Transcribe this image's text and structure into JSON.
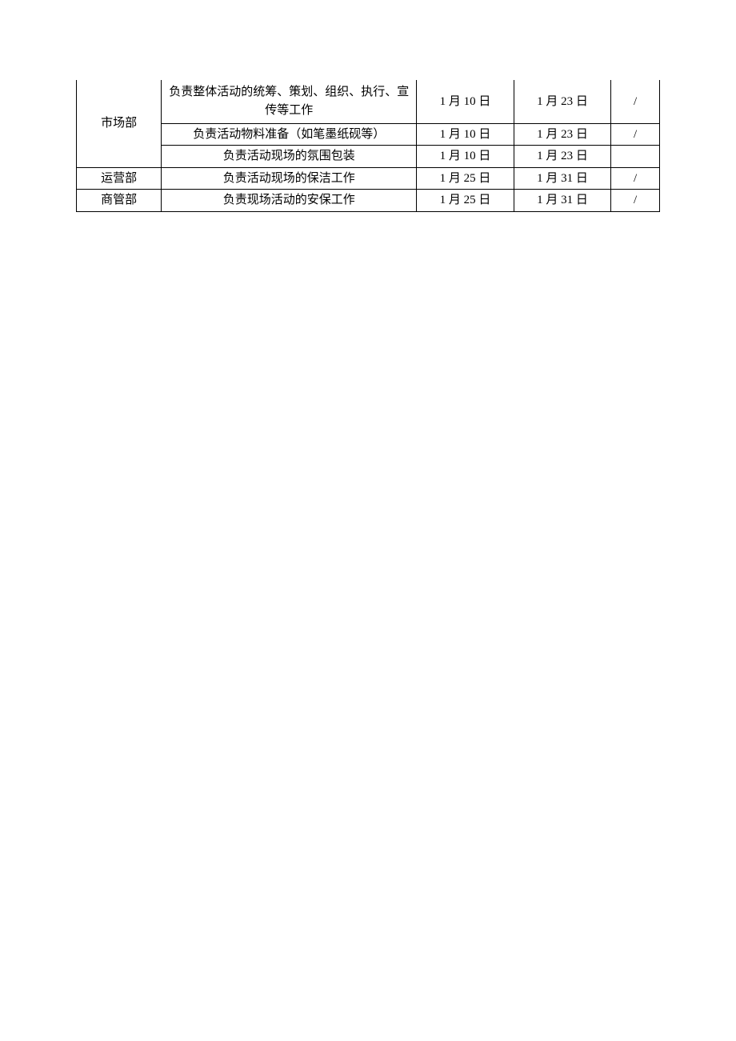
{
  "table": {
    "rows": [
      {
        "dept": "市场部",
        "dept_rowspan": 3,
        "task": "负责整体活动的统筹、策划、组织、执行、宣传等工作",
        "start": "1 月 10 日",
        "end": "1 月 23 日",
        "last": "/",
        "tall": true
      },
      {
        "task": "负责活动物料准备（如笔墨纸砚等）",
        "start": "1 月 10 日",
        "end": "1 月 23 日",
        "last": "/"
      },
      {
        "task": "负责活动现场的氛围包装",
        "start": "1 月 10 日",
        "end": "1 月 23 日",
        "last": ""
      },
      {
        "dept": "运营部",
        "task": "负责活动现场的保洁工作",
        "start": "1 月 25 日",
        "end": "1 月 31 日",
        "last": "/"
      },
      {
        "dept": "商管部",
        "task": "负责现场活动的安保工作",
        "start": "1 月 25 日",
        "end": "1 月 31 日",
        "last": "/"
      }
    ]
  }
}
